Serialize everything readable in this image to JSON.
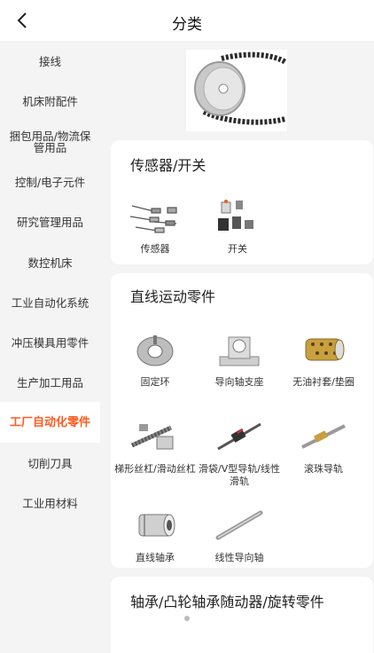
{
  "header": {
    "title": "分类"
  },
  "sidebar": {
    "items": [
      {
        "label": "接线"
      },
      {
        "label": "机床附配件"
      },
      {
        "label": "捆包用品/物流保管用品"
      },
      {
        "label": "控制/电子元件"
      },
      {
        "label": "研究管理用品"
      },
      {
        "label": "数控机床"
      },
      {
        "label": "工业自动化系统"
      },
      {
        "label": "冲压模具用零件"
      },
      {
        "label": "生产加工用品"
      },
      {
        "label": "工厂自动化零件"
      },
      {
        "label": "切削刀具"
      },
      {
        "label": "工业用材料"
      }
    ],
    "active_index": 9
  },
  "sections": [
    {
      "title": "传感器/开关",
      "items": [
        {
          "label": "传感器",
          "icon": "sensor-icon"
        },
        {
          "label": "开关",
          "icon": "switch-icon"
        }
      ]
    },
    {
      "title": "直线运动零件",
      "items": [
        {
          "label": "固定环",
          "icon": "fixing-ring-icon"
        },
        {
          "label": "导向轴支座",
          "icon": "shaft-support-icon"
        },
        {
          "label": "无油衬套/垫圈",
          "icon": "bushing-icon"
        },
        {
          "label": "梯形丝杠/滑动丝杠",
          "icon": "lead-screw-icon"
        },
        {
          "label": "滑袋/V型导轨/线性滑轨",
          "icon": "linear-slide-icon"
        },
        {
          "label": "滚珠导轨",
          "icon": "ball-guide-icon"
        },
        {
          "label": "直线轴承",
          "icon": "linear-bearing-icon"
        },
        {
          "label": "线性导向轴",
          "icon": "linear-shaft-icon"
        }
      ]
    },
    {
      "title": "轴承/凸轮轴承随动器/旋转零件"
    }
  ],
  "colors": {
    "accent": "#ff5a1f",
    "background": "#f4f4f4",
    "card": "#ffffff"
  }
}
